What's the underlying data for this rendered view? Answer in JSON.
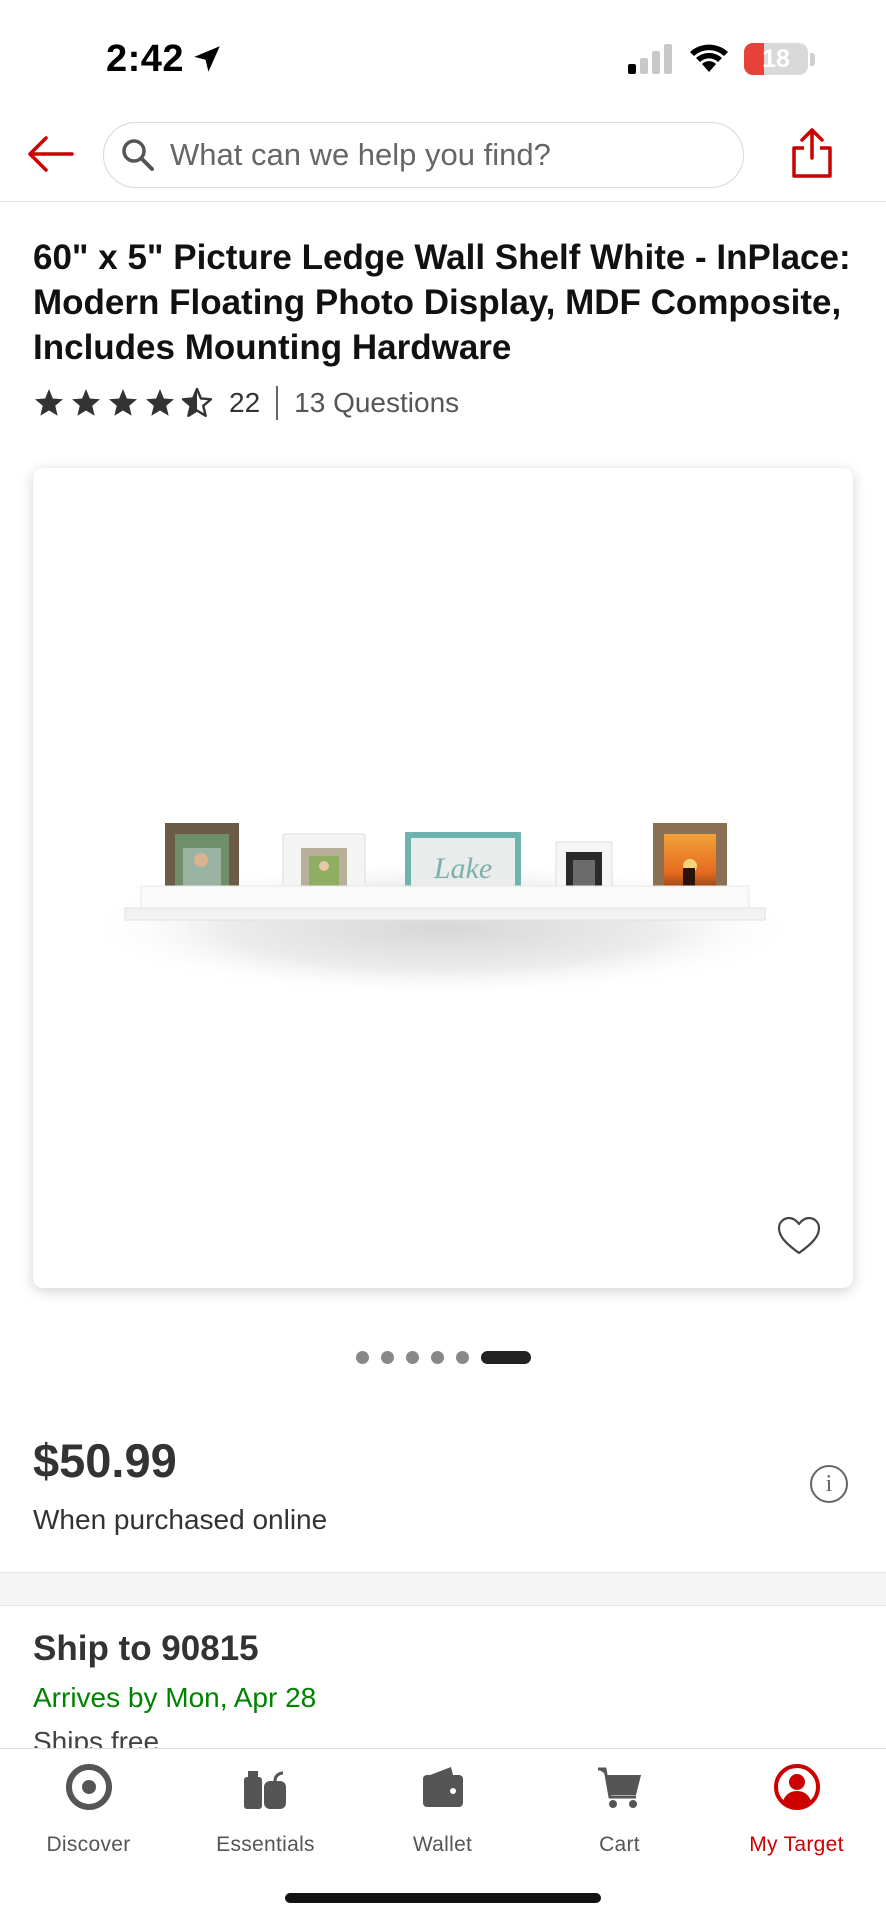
{
  "status_bar": {
    "time": "2:42",
    "battery": "18"
  },
  "search": {
    "placeholder": "What can we help you find?"
  },
  "product": {
    "title": "60\" x 5\" Picture Ledge Wall Shelf White - InPlace: Modern Floating Photo Display, MDF Composite, Includes Mounting Hardware",
    "rating": 4.5,
    "rating_count": "22",
    "questions": "13 Questions",
    "image_carousel": {
      "total": 6,
      "active_index": 5
    },
    "price": "$50.99",
    "price_note": "When purchased online"
  },
  "shipping": {
    "title": "Ship to 90815",
    "arrives": "Arrives by Mon, Apr 28",
    "note": "Ships free"
  },
  "bottom_nav": {
    "items": [
      {
        "label": "Discover",
        "icon": "target-icon"
      },
      {
        "label": "Essentials",
        "icon": "essentials-icon"
      },
      {
        "label": "Wallet",
        "icon": "wallet-icon"
      },
      {
        "label": "Cart",
        "icon": "cart-icon"
      },
      {
        "label": "My Target",
        "icon": "account-icon",
        "active": true
      }
    ]
  },
  "colors": {
    "brand": "#cc0000",
    "arrives": "#008300"
  }
}
